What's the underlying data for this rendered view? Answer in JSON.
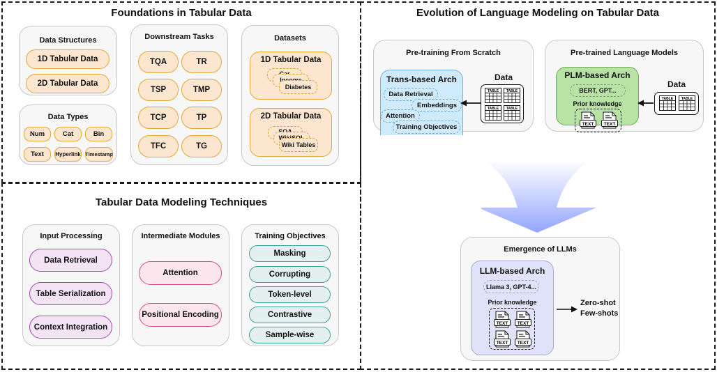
{
  "foundations": {
    "title": "Foundations in Tabular Data",
    "data_structures": {
      "title": "Data Structures",
      "items": [
        "1D Tabular Data",
        "2D Tabular Data"
      ]
    },
    "data_types": {
      "title": "Data Types",
      "items": [
        "Num",
        "Cat",
        "Bin",
        "Text",
        "Hyperlink",
        "Timestamp"
      ]
    },
    "downstream_tasks": {
      "title": "Downstream Tasks",
      "items": [
        "TQA",
        "TR",
        "TSP",
        "TMP",
        "TCP",
        "TP",
        "TFC",
        "TG"
      ]
    },
    "datasets": {
      "title": "Datasets",
      "groups": [
        {
          "title": "1D Tabular Data",
          "cards": [
            "Car",
            "Income",
            "Diabetes"
          ]
        },
        {
          "title": "2D Tabular Data",
          "cards": [
            "SQA",
            "WikiSQL",
            "Wiki Tables"
          ]
        }
      ]
    }
  },
  "techniques": {
    "title": "Tabular Data Modeling Techniques",
    "input_processing": {
      "title": "Input Processing",
      "items": [
        "Data Retrieval",
        "Table Serialization",
        "Context Integration"
      ]
    },
    "intermediate_modules": {
      "title": "Intermediate Modules",
      "items": [
        "Attention",
        "Positional Encoding"
      ]
    },
    "training_objectives": {
      "title": "Training Objectives",
      "items": [
        "Masking",
        "Corrupting",
        "Token-level",
        "Contrastive",
        "Sample-wise"
      ]
    }
  },
  "evolution": {
    "title": "Evolution of Language Modeling on Tabular Data",
    "pretraining": {
      "title": "Pre-training From Scratch",
      "arch_title": "Trans-based Arch",
      "arch_items": [
        "Data Retrieval",
        "Embeddings",
        "Attention",
        "Training Objectives"
      ],
      "data_label": "Data",
      "table_label": "TABLE"
    },
    "plm": {
      "title": "Pre-trained Language Models",
      "arch_title": "PLM-based Arch",
      "models": "BERT, GPT...",
      "prior_label": "Prior knowledge",
      "text_label": "TEXT",
      "data_label": "Data",
      "table_label": "TABLE"
    },
    "llm": {
      "title": "Emergence of LLMs",
      "arch_title": "LLM-based Arch",
      "models": "Llama 3, GPT-4...",
      "prior_label": "Prior knowledge",
      "text_label": "TEXT",
      "outputs": [
        "Zero-shot",
        "Few-shots"
      ]
    }
  },
  "colors": {
    "orange_fill": "#fde6cf",
    "orange_border": "#e0a93a",
    "purple_border": "#a44aa8",
    "red_border": "#d84d72",
    "teal_border": "#3ba69c",
    "blue_arch": "#cfeafb",
    "green_arch": "#b9e3a5",
    "lavender_arch": "#dfe2f8",
    "arrow": "#93a5ff"
  }
}
